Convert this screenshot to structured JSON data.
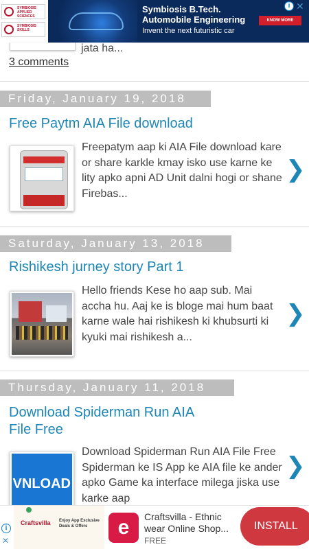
{
  "top_ad": {
    "logo1": "SYMBIOSIS APPLIED SCIENCES",
    "logo2": "SYMBIOSIS SKILLS",
    "title_line1": "Symbiosis B.Tech.",
    "title_line2": "Automobile Engineering",
    "subtitle": "Invent the next futuristic car",
    "cta": "KNOW MORE",
    "info": "i",
    "close": "✕"
  },
  "previous": {
    "snippet_tail": "jata ha...",
    "comments": "3 comments"
  },
  "posts": [
    {
      "date": "Friday, January 19, 2018",
      "title": "Free Paytm AIA File download",
      "snippet": "Freepatym  aap ki AIA File download kare or share karkle kmay isko use karne ke lity apko      apni AD Unit dalni hogi or shane Firebas...",
      "chevron": "❯"
    },
    {
      "date": "Saturday, January 13, 2018",
      "title": "Rishikesh jurney story Part 1",
      "snippet": "Hello friends  Kese ho aap sub. Mai accha hu. Aaj ke is bloge mai hum baat karne wale hai rishikesh ki khubsurti ki kyuki mai rishikesh a...",
      "chevron": "❯"
    },
    {
      "date": "Thursday, January 11, 2018",
      "title_line1": "Download Spiderman Run AIA",
      "title_line2": "File Free",
      "thumb_text": "VNLOAD",
      "snippet": "Download Spiderman Run AIA File Free Spiderman   ke   IS  App ke AIA file ke ander apko Game ka interface milega jiska use karke aap",
      "chevron": "❯"
    }
  ],
  "bottom_ad": {
    "banner_brand": "Craftsvilla",
    "banner_promo_1": "Enjoy App Exclusive",
    "banner_promo_2": "Deals & Offers",
    "app_name": "Craftsvilla - Ethnic wear Online Shop...",
    "app_sub": "FREE",
    "install": "INSTALL",
    "info": "i",
    "close": "✕"
  }
}
